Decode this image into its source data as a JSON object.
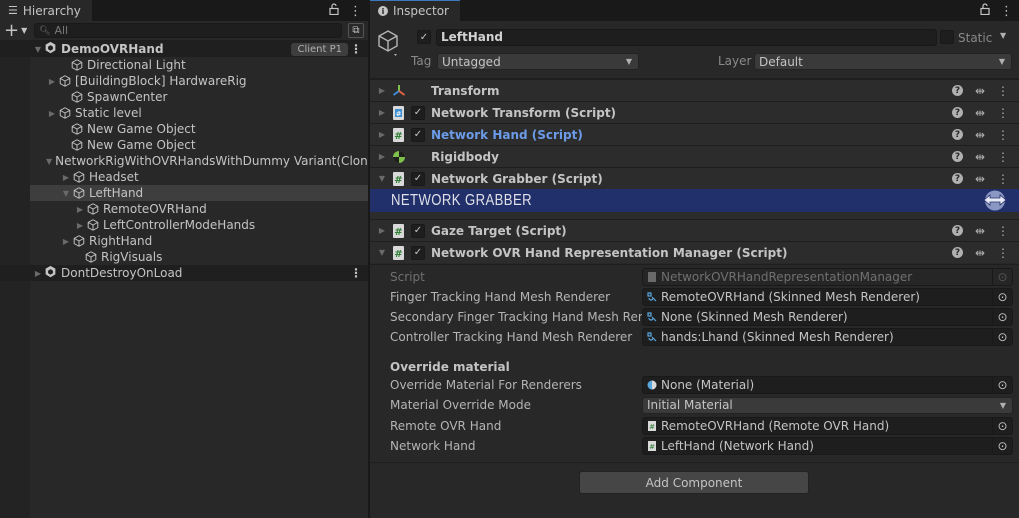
{
  "hierarchy": {
    "tab_label": "Hierarchy",
    "search_placeholder": "All",
    "rows": [
      {
        "label": "DemoOVRHand",
        "depth": 0,
        "type": "scene",
        "expanded": true,
        "badge": "Client P1"
      },
      {
        "label": "Directional Light",
        "depth": 1,
        "type": "object",
        "expandable": false
      },
      {
        "label": "[BuildingBlock] HardwareRig",
        "depth": 1,
        "type": "object",
        "expandable": true,
        "expanded": false
      },
      {
        "label": "SpawnCenter",
        "depth": 1,
        "type": "object",
        "expandable": false
      },
      {
        "label": "Static level",
        "depth": 1,
        "type": "object",
        "expandable": true,
        "expanded": false
      },
      {
        "label": "New Game Object",
        "depth": 1,
        "type": "object",
        "expandable": false
      },
      {
        "label": "New Game Object",
        "depth": 1,
        "type": "object",
        "expandable": false
      },
      {
        "label": "NetworkRigWithOVRHandsWithDummy Variant(Clone)",
        "depth": 1,
        "type": "object",
        "expandable": true,
        "expanded": true
      },
      {
        "label": "Headset",
        "depth": 2,
        "type": "object",
        "expandable": true,
        "expanded": false
      },
      {
        "label": "LeftHand",
        "depth": 2,
        "type": "object",
        "expandable": true,
        "expanded": true,
        "selected": true
      },
      {
        "label": "RemoteOVRHand",
        "depth": 3,
        "type": "object",
        "expandable": true,
        "expanded": false
      },
      {
        "label": "LeftControllerModeHands",
        "depth": 3,
        "type": "object",
        "expandable": true,
        "expanded": false
      },
      {
        "label": "RightHand",
        "depth": 2,
        "type": "object",
        "expandable": true,
        "expanded": false
      },
      {
        "label": "RigVisuals",
        "depth": 2,
        "type": "object",
        "expandable": false
      },
      {
        "label": "DontDestroyOnLoad",
        "depth": 0,
        "type": "scene",
        "expanded": false
      }
    ]
  },
  "inspector": {
    "tab_label": "Inspector",
    "object_name": "LeftHand",
    "active": true,
    "static_label": "Static",
    "tag_label": "Tag",
    "tag_value": "Untagged",
    "layer_label": "Layer",
    "layer_value": "Default",
    "components": [
      {
        "title": "Transform",
        "icon": "transform-icon",
        "has_checkbox": false,
        "expanded": false
      },
      {
        "title": "Network Transform (Script)",
        "icon": "script-icon-blue",
        "has_checkbox": true,
        "expanded": false
      },
      {
        "title": "Network Hand (Script)",
        "icon": "script-icon",
        "has_checkbox": true,
        "expanded": false,
        "highlighted": true
      },
      {
        "title": "Rigidbody",
        "icon": "rigidbody-icon",
        "has_checkbox": false,
        "expanded": false
      },
      {
        "title": "Network Grabber (Script)",
        "icon": "script-icon",
        "has_checkbox": true,
        "expanded": true
      },
      {
        "title": "Gaze Target (Script)",
        "icon": "script-icon",
        "has_checkbox": true,
        "expanded": false
      },
      {
        "title": "Network OVR Hand Representation Manager (Script)",
        "icon": "script-icon",
        "has_checkbox": true,
        "expanded": true
      }
    ],
    "banner_text": "NETWORK GRABBER",
    "properties": [
      {
        "label": "Script",
        "value": "NetworkOVRHandRepresentationManager",
        "icon": "script",
        "disabled": true
      },
      {
        "label": "Finger Tracking Hand Mesh Renderer",
        "value": "RemoteOVRHand (Skinned Mesh Renderer)",
        "icon": "skinned-mesh"
      },
      {
        "label": "Secondary Finger Tracking Hand Mesh Renderer",
        "value": "None (Skinned Mesh Renderer)",
        "icon": "skinned-mesh"
      },
      {
        "label": "Controller Tracking Hand Mesh Renderer",
        "value": "hands:Lhand (Skinned Mesh Renderer)",
        "icon": "skinned-mesh"
      }
    ],
    "section_header": "Override material",
    "properties2": [
      {
        "label": "Override Material For Renderers",
        "value": "None (Material)",
        "icon": "material"
      },
      {
        "label": "Material Override Mode",
        "value": "Initial Material",
        "type": "dropdown"
      },
      {
        "label": "Remote OVR Hand",
        "value": "RemoteOVRHand (Remote OVR Hand)",
        "icon": "script"
      },
      {
        "label": "Network Hand",
        "value": "LeftHand (Network Hand)",
        "icon": "script"
      }
    ],
    "add_component_label": "Add Component"
  },
  "colors": {
    "selection_row": "#3e3e3e",
    "banner_bg": "#21306a",
    "highlight_text": "#6c9be8",
    "tab_accent": "#3a79bb"
  }
}
